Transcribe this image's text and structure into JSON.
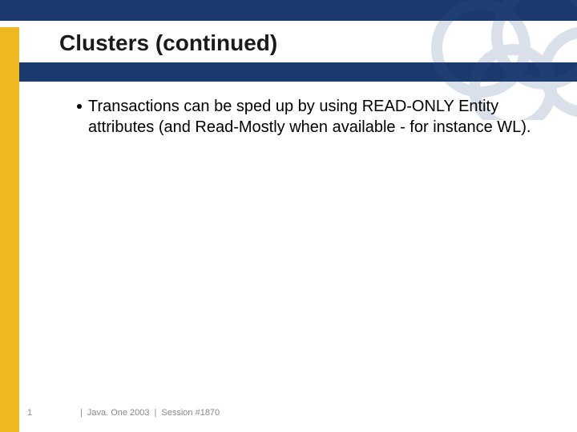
{
  "slide": {
    "title": "Clusters (continued)",
    "bullets": [
      "Transactions can be sped up by using READ-ONLY Entity attributes (and Read-Mostly when available - for instance WL)."
    ]
  },
  "footer": {
    "page_number": "1",
    "event": "Java. One 2003",
    "session": "Session #1870",
    "separator": "|"
  },
  "colors": {
    "accent_blue": "#1a3a6e",
    "accent_gold": "#f0b820"
  }
}
